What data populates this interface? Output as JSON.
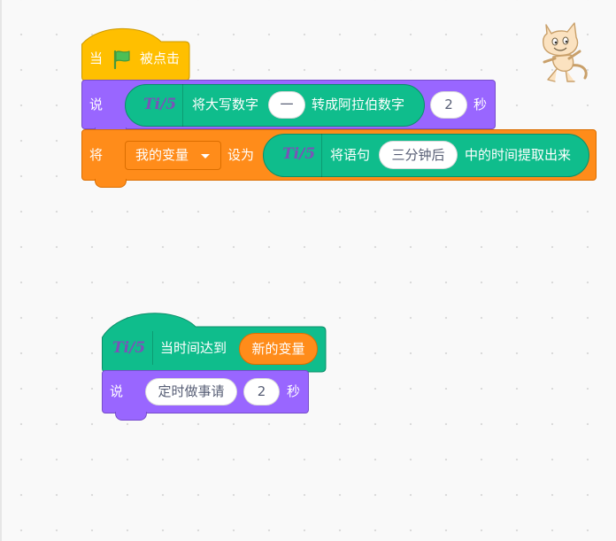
{
  "script1": {
    "hat": {
      "when": "当",
      "clicked": "被点击"
    },
    "say": {
      "label": "说",
      "reporter_logo": "Ti/5",
      "reporter_prefix": "将大写数字",
      "input_value": "一",
      "reporter_suffix": "转成阿拉伯数字",
      "seconds_value": "2",
      "seconds_label": "秒"
    },
    "set": {
      "label": "将",
      "variable": "我的变量",
      "to_label": "设为",
      "reporter_logo": "Ti/5",
      "reporter_prefix": "将语句",
      "input_value": "三分钟后",
      "reporter_suffix": "中的时间提取出来"
    }
  },
  "script2": {
    "hat": {
      "logo": "Ti/5",
      "label": "当时间达到",
      "variable": "新的变量"
    },
    "say": {
      "label": "说",
      "message": "定时做事请",
      "seconds_value": "2",
      "seconds_label": "秒"
    }
  },
  "icons": {
    "green_flag": "green-flag-icon",
    "dropdown": "caret-down-icon",
    "sprite": "scratch-cat-icon"
  },
  "colors": {
    "events": "#ffbf00",
    "looks": "#9966ff",
    "variables": "#ff8c1a",
    "extension": "#0fbd8c",
    "canvas": "#f9f9f9"
  }
}
